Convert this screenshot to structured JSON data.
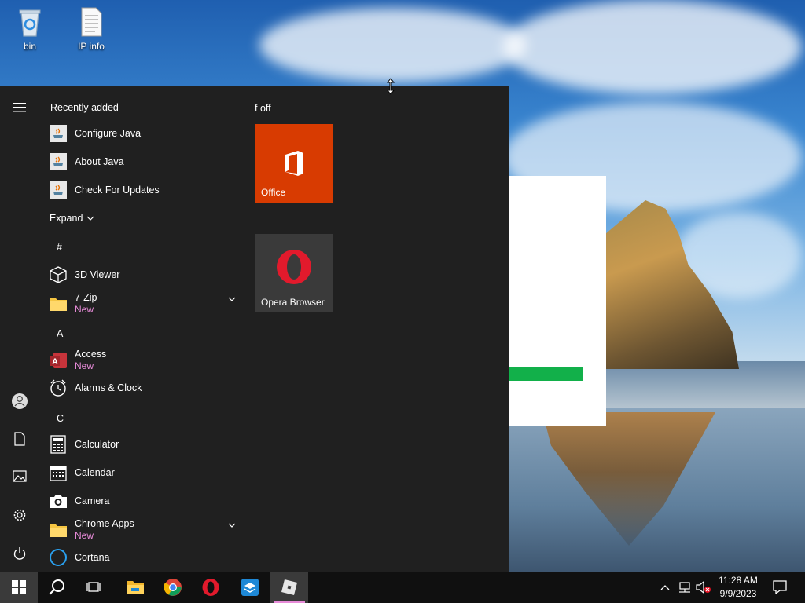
{
  "desktop": {
    "icons": [
      {
        "label": "bin",
        "icon": "recycle-bin-icon"
      },
      {
        "label": "IP info",
        "icon": "text-file-icon"
      }
    ]
  },
  "start_menu": {
    "recently_added_title": "Recently added",
    "recent_apps": [
      "Configure Java",
      "About Java",
      "Check For Updates"
    ],
    "expand_label": "Expand",
    "letters": [
      "#",
      "A",
      "C"
    ],
    "apps": [
      {
        "name": "3D Viewer",
        "icon": "cube-icon"
      },
      {
        "name": "7-Zip",
        "sub": "New",
        "icon": "folder-icon",
        "expandable": true
      },
      {
        "name": "Access",
        "sub": "New",
        "icon": "access-icon"
      },
      {
        "name": "Alarms & Clock",
        "icon": "alarm-clock-icon"
      },
      {
        "name": "Calculator",
        "icon": "calculator-icon"
      },
      {
        "name": "Calendar",
        "icon": "calendar-icon"
      },
      {
        "name": "Camera",
        "icon": "camera-icon"
      },
      {
        "name": "Chrome Apps",
        "sub": "New",
        "icon": "folder-icon",
        "expandable": true
      },
      {
        "name": "Cortana",
        "icon": "cortana-icon"
      }
    ],
    "tile_group_title": "f off",
    "tiles": [
      {
        "label": "Office",
        "color": "#d83b01",
        "icon": "office-icon"
      },
      {
        "label": "Opera Browser",
        "color": "#3a3a3a",
        "icon": "opera-icon"
      }
    ],
    "rail": [
      "hamburger-icon",
      "user-icon",
      "document-icon",
      "pictures-icon",
      "settings-icon",
      "power-icon"
    ]
  },
  "taskbar": {
    "items": [
      "windows-start-icon",
      "search-icon",
      "task-view-icon",
      "file-explorer-icon",
      "chrome-icon",
      "opera-icon",
      "app-icon",
      "roblox-icon"
    ],
    "time": "11:28 AM",
    "date": "9/9/2023"
  },
  "colors": {
    "start_bg": "#202020",
    "taskbar_bg": "#101010",
    "new_badge": "#e78bd8",
    "office_tile": "#d83b01",
    "progress_green": "#12b04a"
  }
}
